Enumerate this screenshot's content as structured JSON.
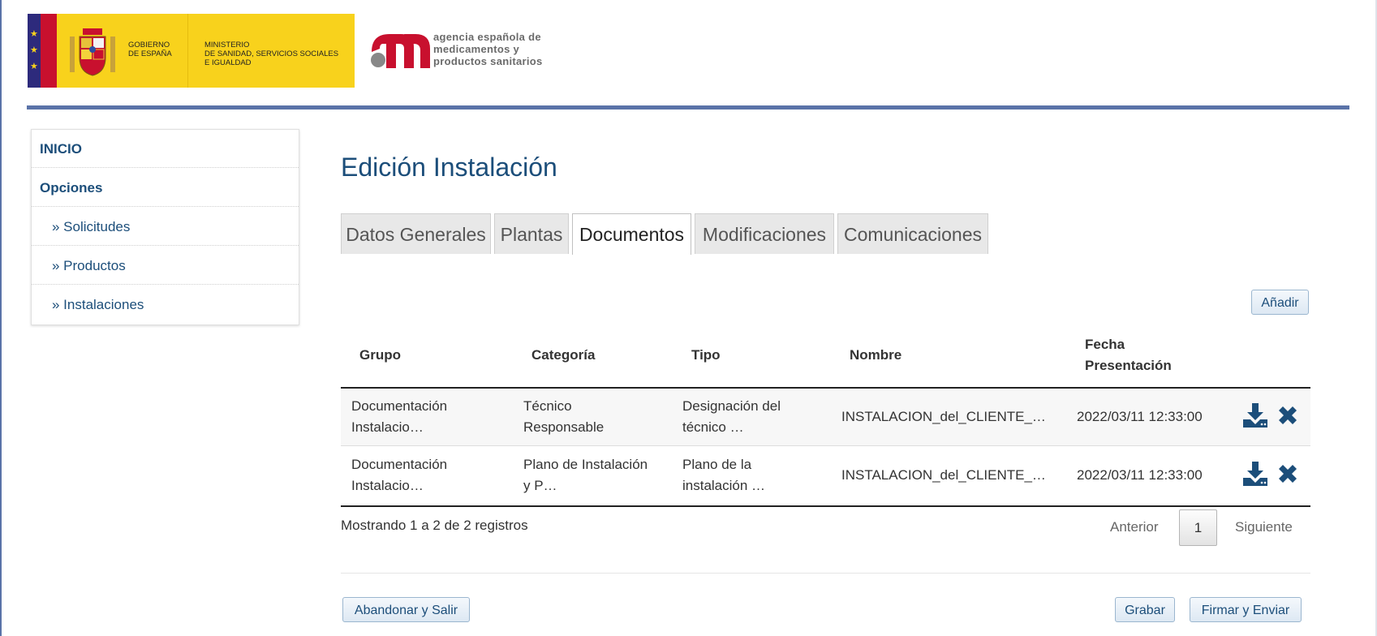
{
  "header": {
    "gov_line1": "GOBIERNO\nDE ESPAÑA",
    "ministry": "MINISTERIO\nDE SANIDAD, SERVICIOS SOCIALES\nE IGUALDAD",
    "agency": "agencia española de\nmedicamentos y\nproductos sanitarios",
    "accent_color": "#5a73a8"
  },
  "sidebar": {
    "items": [
      {
        "label": "INICIO"
      },
      {
        "label": "Opciones"
      },
      {
        "label": "» Solicitudes"
      },
      {
        "label": "» Productos"
      },
      {
        "label": "» Instalaciones"
      }
    ]
  },
  "main": {
    "title": "Edición Instalación",
    "tabs": [
      {
        "label": "Datos Generales"
      },
      {
        "label": "Plantas"
      },
      {
        "label": "Documentos",
        "active": true
      },
      {
        "label": "Modificaciones"
      },
      {
        "label": "Comunicaciones"
      }
    ],
    "add_button": "Añadir",
    "table": {
      "headers": [
        "Grupo",
        "Categoría",
        "Tipo",
        "Nombre",
        "Fecha Presentación"
      ],
      "rows": [
        {
          "grupo": "Documentación\nInstalacio…",
          "categoria": "Técnico\nResponsable",
          "tipo": "Designación del\ntécnico …",
          "nombre": "INSTALACION_del_CLIENTE_…",
          "fecha": "2022/03/11 12:33:00"
        },
        {
          "grupo": "Documentación\nInstalacio…",
          "categoria": "Plano de Instalación\ny P…",
          "tipo": "Plano de la\ninstalación …",
          "nombre": "INSTALACION_del_CLIENTE_…",
          "fecha": "2022/03/11 12:33:00"
        }
      ]
    },
    "pagination": {
      "info": "Mostrando 1 a 2 de 2 registros",
      "previous": "Anterior",
      "current": "1",
      "next": "Siguiente"
    },
    "footer_buttons": {
      "abandon": "Abandonar y Salir",
      "save": "Grabar",
      "sign_send": "Firmar y Enviar"
    }
  }
}
